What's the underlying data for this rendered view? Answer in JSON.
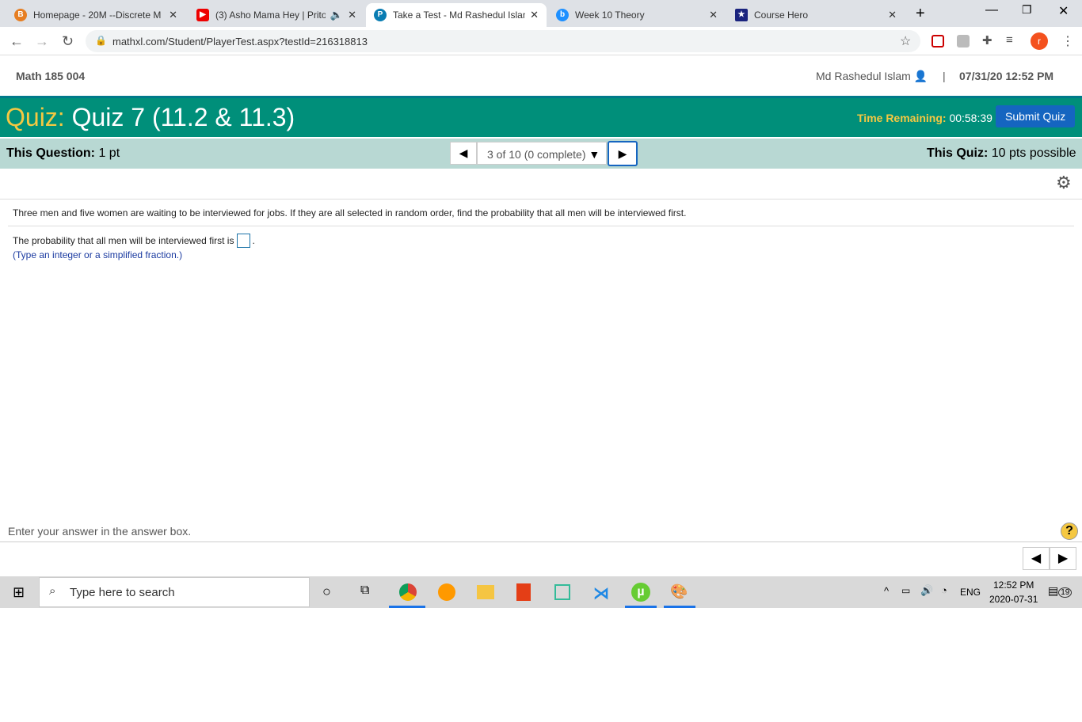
{
  "browser": {
    "tabs": [
      {
        "title": "Homepage - 20M --Discrete M",
        "icon": "bartleby-icon",
        "color": "#e67e22"
      },
      {
        "title": "(3) Asho Mama Hey | Prito",
        "icon": "youtube-icon",
        "color": "#e00"
      },
      {
        "title": "Take a Test - Md Rashedul Islam",
        "icon": "pearson-icon",
        "color": "#0a7db3"
      },
      {
        "title": "Week 10 Theory",
        "icon": "bing-icon",
        "color": "#1e90ff"
      },
      {
        "title": "Course Hero",
        "icon": "coursehero-icon",
        "color": "#1a237e"
      }
    ],
    "url": "mathxl.com/Student/PlayerTest.aspx?testId=216318813",
    "profile": "r"
  },
  "header": {
    "course": "Math 185 004",
    "user": "Md Rashedul Islam",
    "separator": "|",
    "datetime": "07/31/20 12:52 PM"
  },
  "quiz": {
    "label": "Quiz:",
    "title": "Quiz 7 (11.2 & 11.3)",
    "time_label": "Time Remaining:",
    "time": "00:58:39",
    "submit": "Submit Quiz"
  },
  "info": {
    "q_label": "This Question:",
    "q_value": "1 pt",
    "nav": "3 of 10 (0 complete)",
    "quiz_label": "This Quiz:",
    "quiz_value": "10 pts possible"
  },
  "question": {
    "text": "Three men and five women are waiting to be interviewed for jobs. If they are all selected in random order, find the probability that all men will be interviewed first.",
    "answer_prefix": "The probability that all men will be interviewed first is",
    "answer_value": "",
    "answer_suffix": ".",
    "hint": "(Type an integer or a simplified fraction.)"
  },
  "footer": {
    "status": "Enter your answer in the answer box.",
    "help": "?"
  },
  "taskbar": {
    "search": "Type here to search",
    "lang": "ENG",
    "time": "12:52 PM",
    "date": "2020-07-31",
    "notifications": "19"
  }
}
